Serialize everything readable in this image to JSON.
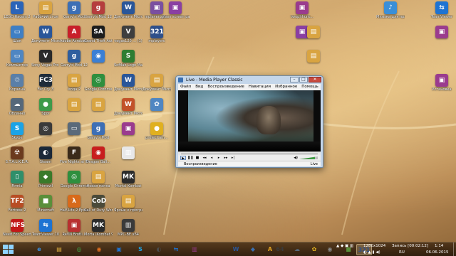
{
  "desktop": {
    "icons": [
      {
        "label": "LEGO Racers 2",
        "glyph": "L",
        "color": "#2b64b8",
        "icon": "lego-racers-icon"
      },
      {
        "label": "Рабочий стол",
        "glyph": "▤",
        "color": "#d9a441",
        "icon": "folder-icon"
      },
      {
        "label": "Garry's Mod",
        "glyph": "g",
        "color": "#3d6fb5",
        "icon": "garrys-mod-icon"
      },
      {
        "label": "Garry's Mod 12",
        "glyph": "g",
        "color": "#b53d3d",
        "icon": "garrys-mod-icon"
      },
      {
        "label": "Документ Microsoft...",
        "glyph": "W",
        "color": "#2a5699",
        "icon": "word-document-icon"
      },
      {
        "label": "mplayerc_6...",
        "glyph": "▣",
        "color": "#7a4fa0",
        "icon": "archive-icon"
      },
      {
        "label": "green screen pack (1)",
        "glyph": "▣",
        "color": "#8a3fa2",
        "icon": "archive-icon"
      },
      {
        "label": "twoplrhunt...",
        "glyph": "▣",
        "color": "#9a3b8e",
        "icon": "archive-icon"
      },
      {
        "label": "Музыка для праздника...",
        "glyph": "♪",
        "color": "#3a8fd8",
        "icon": "music-icon"
      },
      {
        "label": "TeamViewer",
        "glyph": "⇆",
        "color": "#1e73d2",
        "icon": "teamviewer-icon"
      },
      {
        "label": "Шак",
        "glyph": "▭",
        "color": "#3f7fc4",
        "icon": "disc-icon"
      },
      {
        "label": "Документ Microsoft...",
        "glyph": "W",
        "color": "#2a5699",
        "icon": "word-document-icon"
      },
      {
        "label": "Adobe Acrobat...",
        "glyph": "A",
        "color": "#c8202a",
        "icon": "acrobat-icon"
      },
      {
        "label": "Grand Theft Auto San...",
        "glyph": "SA",
        "color": "#1d1d1d",
        "icon": "gta-icon"
      },
      {
        "label": "vegas120 ... (1)",
        "glyph": "V",
        "color": "#3e3e3e",
        "icon": "vegas-icon"
      },
      {
        "label": "mplayerc",
        "glyph": "321",
        "color": "#2e4f8a",
        "icon": "mpc-icon"
      },
      {
        "label": "",
        "glyph": "▣",
        "color": "#8a3fa2",
        "icon": "archive-icon"
      },
      {
        "label": "",
        "glyph": "▤",
        "color": "#d9a441",
        "icon": "folder-icon"
      },
      {
        "label": "",
        "glyph": "▣",
        "color": "#9a3b8e",
        "icon": "archive-icon"
      },
      {
        "label": "Компьютер",
        "glyph": "▭",
        "color": "#4f86c2",
        "icon": "computer-icon"
      },
      {
        "label": "Sony Vegas Pro 12.0...",
        "glyph": "V",
        "color": "#2a2a2a",
        "icon": "vegas-icon"
      },
      {
        "label": "Garry's Mod 12",
        "glyph": "g",
        "color": "#2f5e9e",
        "icon": "garrys-mod-icon"
      },
      {
        "label": "",
        "glyph": "◉",
        "color": "#3b7fd4",
        "icon": "google-earth-icon"
      },
      {
        "label": "Softlab Logo Maker Pro",
        "glyph": "S",
        "color": "#2e7d32",
        "icon": "logo-maker-icon"
      },
      {
        "label": "",
        "glyph": "▤",
        "color": "#d9a441",
        "icon": "folder-icon"
      },
      {
        "label": "Корзина",
        "glyph": "♲",
        "color": "#5a7fa8",
        "icon": "recycle-bin-icon"
      },
      {
        "label": "Far Cry 3",
        "glyph": "FC3",
        "color": "#1f2c3a",
        "icon": "far-cry-icon"
      },
      {
        "label": "мода 2",
        "glyph": "▤",
        "color": "#d9a441",
        "icon": "folder-icon"
      },
      {
        "label": "Google Chrome",
        "glyph": "◎",
        "color": "#2f8f3e",
        "icon": "chrome-icon"
      },
      {
        "label": "Документ Microsoft...",
        "glyph": "W",
        "color": "#2a5699",
        "icon": "word-document-icon"
      },
      {
        "label": "Документ Microsoft...",
        "glyph": "▤",
        "color": "#d9a441",
        "icon": "folder-icon"
      },
      {
        "label": "Установка",
        "glyph": "▣",
        "color": "#9a3b8e",
        "icon": "archive-icon"
      },
      {
        "label": "Облачно",
        "glyph": "☁",
        "color": "#56687a",
        "icon": "cloud-icon"
      },
      {
        "label": "Spor",
        "glyph": "●",
        "color": "#3e9a4a",
        "icon": "spore-icon"
      },
      {
        "label": "",
        "glyph": "▤",
        "color": "#d9a441",
        "icon": "folder-icon"
      },
      {
        "label": "",
        "glyph": "▤",
        "color": "#d9a441",
        "icon": "folder-icon"
      },
      {
        "label": "Документ Microsoft...",
        "glyph": "W",
        "color": "#c2522a",
        "icon": "ppt-document-icon"
      },
      {
        "label": "",
        "glyph": "✿",
        "color": "#4f86c2",
        "icon": "photo-icon"
      },
      {
        "label": "Skype",
        "glyph": "S",
        "color": "#1ba3e6",
        "icon": "skype-icon"
      },
      {
        "label": "",
        "glyph": "◎",
        "color": "#3a3a3a",
        "icon": "half-life-icon"
      },
      {
        "label": "",
        "glyph": "▭",
        "color": "#5a6a7a",
        "icon": "window-icon"
      },
      {
        "label": "Garry's Mod",
        "glyph": "g",
        "color": "#3d6fb5",
        "icon": "garrys-mod-icon"
      },
      {
        "label": "",
        "glyph": "▣",
        "color": "#9a3b8e",
        "icon": "archive-icon"
      },
      {
        "label": "project.am...",
        "glyph": "●",
        "color": "#e0b020",
        "icon": "paint-icon"
      },
      {
        "label": "S.T.A.L.K.E.R.",
        "glyph": "☢",
        "color": "#6b3a1e",
        "icon": "stalker-icon"
      },
      {
        "label": "Steam",
        "glyph": "◐",
        "color": "#1b2838",
        "icon": "steam-icon"
      },
      {
        "label": "Five Nights at Freddy's",
        "glyph": "F",
        "color": "#3a2a1a",
        "icon": "fnaf-icon"
      },
      {
        "label": "Dragon Ball...",
        "glyph": "◉",
        "color": "#c81e1e",
        "icon": "dragon-icon"
      },
      {
        "label": "",
        "glyph": "▥",
        "color": "#e8e8e8",
        "icon": "film-icon"
      },
      {
        "label": "Firmia",
        "glyph": "▯",
        "color": "#2f8f6a",
        "icon": "phone-icon"
      },
      {
        "label": "Primevil",
        "glyph": "◆",
        "color": "#3a7a2a",
        "icon": "game-icon"
      },
      {
        "label": "Google Chrome",
        "glyph": "◎",
        "color": "#2f8f3e",
        "icon": "chrome-icon"
      },
      {
        "label": "Новая папка",
        "glyph": "▤",
        "color": "#d9a441",
        "icon": "folder-icon"
      },
      {
        "label": "Mortal Kombat",
        "glyph": "MK",
        "color": "#2b2b2b",
        "icon": "mortal-kombat-icon"
      },
      {
        "label": "Fortress 2",
        "glyph": "TF2",
        "color": "#b84d24",
        "icon": "tf2-icon"
      },
      {
        "label": "Minecraft",
        "glyph": "■",
        "color": "#5a8f3a",
        "icon": "minecraft-icon"
      },
      {
        "label": "Half-Life 2 Episode...",
        "glyph": "λ",
        "color": "#d86a1a",
        "icon": "half-life-icon"
      },
      {
        "label": "Call of Duty World at War",
        "glyph": "CoD",
        "color": "#4a4a3a",
        "icon": "cod-icon"
      },
      {
        "label": "Ярлык к программе...",
        "glyph": "▤",
        "color": "#d9a441",
        "icon": "folder-icon"
      },
      {
        "label": "Need For Speed ...",
        "glyph": "NFS",
        "color": "#c21818",
        "icon": "nfs-icon"
      },
      {
        "label": "TeamViewer 10",
        "glyph": "⇆",
        "color": "#1e73d2",
        "icon": "teamviewer-icon"
      },
      {
        "label": "ReVN Brotli...",
        "glyph": "▣",
        "color": "#b83030",
        "icon": "archive-icon"
      },
      {
        "label": "Mortal Kombat 9",
        "glyph": "MK",
        "color": "#2b2b2b",
        "icon": "mortal-kombat-icon"
      },
      {
        "label": "MPC-BE x64",
        "glyph": "▥",
        "color": "#3a3a3a",
        "icon": "mpc-be-icon"
      }
    ]
  },
  "mpc": {
    "title": "Live - Media Player Classic",
    "menu": [
      "Файл",
      "Вид",
      "Воспроизведение",
      "Навигация",
      "Избранное",
      "Помощь"
    ],
    "status_left": "Воспроизведение",
    "status_right": "Live"
  },
  "taskbar": {
    "buttons": [
      {
        "glyph": "e",
        "color": "#3a8fe0",
        "icon": "ie-icon"
      },
      {
        "glyph": "▤",
        "color": "#e0b040",
        "icon": "explorer-icon"
      },
      {
        "glyph": "◎",
        "color": "#3fae4a",
        "icon": "chrome-icon"
      },
      {
        "glyph": "◉",
        "color": "#e07020",
        "icon": "firefox-icon"
      },
      {
        "glyph": "▣",
        "color": "#1e73d2",
        "icon": "windows-store-icon"
      },
      {
        "glyph": "S",
        "color": "#1ba3e6",
        "icon": "skype-icon"
      },
      {
        "glyph": "◐",
        "color": "#4a4a4a",
        "icon": "steam-icon"
      },
      {
        "glyph": "⇆",
        "color": "#1e73d2",
        "icon": "teamviewer-icon"
      },
      {
        "glyph": "▥",
        "color": "#9a3b8e",
        "icon": "winrar-icon"
      },
      {
        "glyph": "W",
        "color": "#2a5699",
        "icon": "word-icon"
      },
      {
        "glyph": "◆",
        "color": "#3a6fb0",
        "icon": "app-icon"
      },
      {
        "glyph": "A",
        "color": "#e0a020",
        "icon": "app-icon"
      },
      {
        "glyph": "64",
        "color": "#3a3a3a",
        "icon": "mpc-be-icon"
      },
      {
        "glyph": "☁",
        "color": "#56687a",
        "icon": "cloud-icon"
      },
      {
        "glyph": "✿",
        "color": "#e0b020",
        "icon": "paint-icon"
      },
      {
        "glyph": "◉",
        "color": "#888888",
        "icon": "app-icon"
      },
      {
        "glyph": "■",
        "color": "#5a8f3a",
        "icon": "minecraft-icon"
      },
      {
        "glyph": "321",
        "color": "#2e4f8a",
        "icon": "mpc-icon"
      }
    ],
    "tray": {
      "resolution": "1280x1024",
      "recording": "Запись [00:02:12]",
      "language": "RU",
      "time": "1:14",
      "date": "06.06.2015"
    }
  }
}
